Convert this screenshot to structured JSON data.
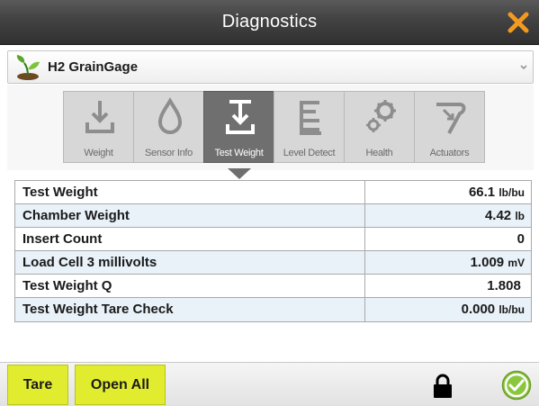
{
  "window": {
    "title": "Diagnostics",
    "close_icon": "close-x-icon",
    "accent_color": "#f39a1e"
  },
  "device": {
    "name": "H2 GrainGage",
    "logo_icon": "sprout-logo-icon",
    "dropdown_icon": "chevron-down-icon"
  },
  "tabs": [
    {
      "label": "Weight",
      "icon": "weight-download-icon",
      "active": false
    },
    {
      "label": "Sensor Info",
      "icon": "droplet-icon",
      "active": false
    },
    {
      "label": "Test Weight",
      "icon": "test-weight-icon",
      "active": true
    },
    {
      "label": "Level Detect",
      "icon": "level-bars-icon",
      "active": false
    },
    {
      "label": "Health",
      "icon": "gears-icon",
      "active": false
    },
    {
      "label": "Actuators",
      "icon": "actuator-icon",
      "active": false
    }
  ],
  "table": {
    "rows": [
      {
        "label": "Test Weight",
        "value": "66.1",
        "unit": "lb/bu"
      },
      {
        "label": "Chamber Weight",
        "value": "4.42",
        "unit": "lb"
      },
      {
        "label": "Insert Count",
        "value": "0",
        "unit": ""
      },
      {
        "label": "Load Cell 3 millivolts",
        "value": "1.009",
        "unit": "mV"
      },
      {
        "label": "Test Weight Q",
        "value": "1.808",
        "unit": ""
      },
      {
        "label": "Test Weight Tare Check",
        "value": "0.000",
        "unit": "lb/bu"
      }
    ]
  },
  "footer": {
    "tare_label": "Tare",
    "open_all_label": "Open All",
    "lock_icon": "lock-icon",
    "ok_icon": "check-circle-icon",
    "button_color": "#e2ec2e"
  }
}
